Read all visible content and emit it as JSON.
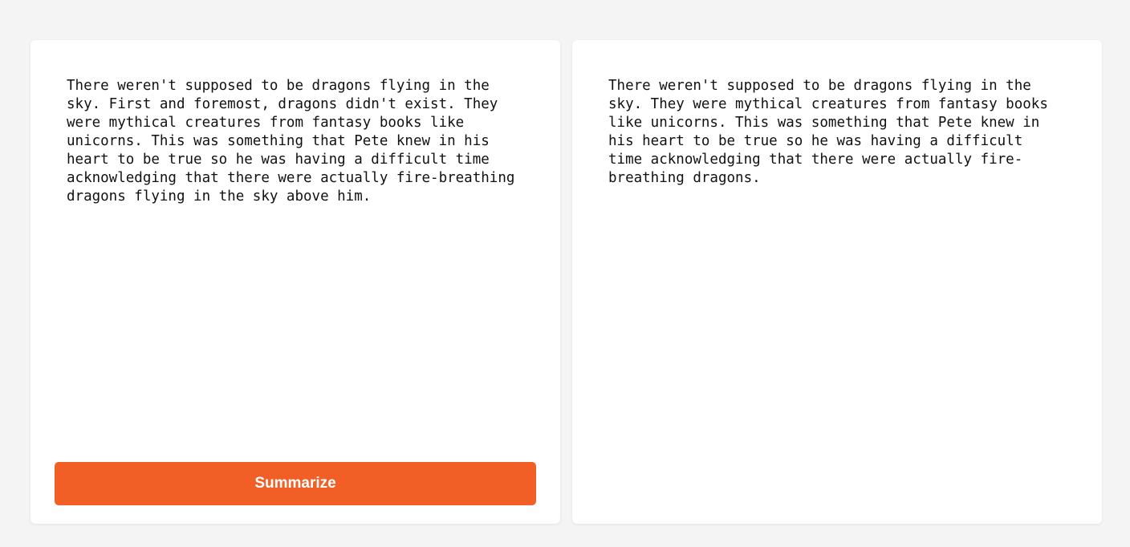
{
  "input_panel": {
    "text": "There weren't supposed to be dragons flying in the\nsky. First and foremost, dragons didn't exist. They\nwere mythical creatures from fantasy books like\nunicorns. This was something that Pete knew in his\nheart to be true so he was having a difficult time\nacknowledging that there were actually fire-breathing\ndragons flying in the sky above him."
  },
  "summarize_button": {
    "label": "Summarize"
  },
  "output_panel": {
    "text": "There weren't supposed to be dragons flying in the\nsky. They were mythical creatures from fantasy books\nlike unicorns. This was something that Pete knew in\nhis heart to be true so he was having a difficult\ntime acknowledging that there were actually fire-\nbreathing dragons."
  },
  "colors": {
    "accent": "#f15f26",
    "background": "#f4f4f4",
    "panel": "#ffffff"
  }
}
